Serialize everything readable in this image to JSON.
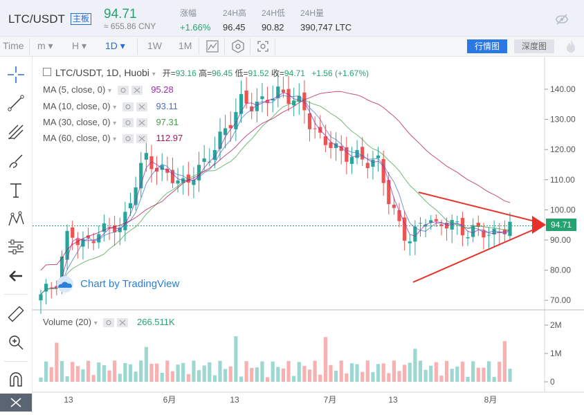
{
  "header": {
    "pair": "LTC/USDT",
    "board_badge": "主板",
    "price": "94.71",
    "price_cny": "≈ 655.86 CNY",
    "stats": [
      {
        "label": "涨幅",
        "value": "+1.66%",
        "color": "#26a270"
      },
      {
        "label": "24H高",
        "value": "96.45",
        "color": "#333333"
      },
      {
        "label": "24H低",
        "value": "90.82",
        "color": "#333333"
      },
      {
        "label": "24H量",
        "value": "390,747 LTC",
        "color": "#333333"
      }
    ]
  },
  "toolbar": {
    "time_label": "Time",
    "minute_label": "m",
    "hour_label": "H",
    "active_interval": "1D",
    "week_label": "1W",
    "month_label": "1M",
    "depth_button": "深度图",
    "market_button": "行情图"
  },
  "legend": {
    "symbol": "LTC/USDT, 1D, Huobi",
    "open_label": "开=",
    "open": "93.16",
    "high_label": "高=",
    "high": "96.45",
    "low_label": "低=",
    "low": "91.52",
    "close_label": "收=",
    "close": "94.71",
    "change": "+1.56 (+1.67%)"
  },
  "ma": [
    {
      "label": "MA (5, close, 0)",
      "value": "95.28",
      "color": "#9c27b0"
    },
    {
      "label": "MA (10, close, 0)",
      "value": "93.11",
      "color": "#4a6fc9"
    },
    {
      "label": "MA (30, close, 0)",
      "value": "97.31",
      "color": "#43a047"
    },
    {
      "label": "MA (60, close, 0)",
      "value": "112.97",
      "color": "#ad1457"
    }
  ],
  "price_axis": [
    "140.00",
    "130.00",
    "120.00",
    "110.00",
    "100.00",
    "90.00",
    "80.00",
    "70.00"
  ],
  "current_price_tag": "94.71",
  "watermark": "Chart by TradingView",
  "volume": {
    "label": "Volume (20)",
    "value": "266.511K",
    "axis": [
      "2M",
      "1M",
      "0"
    ]
  },
  "time_axis": [
    "13",
    "6月",
    "13",
    "7月",
    "13",
    "8月"
  ],
  "colors": {
    "up": "#26a69a",
    "down": "#ef5350",
    "accent": "#2a6cd6",
    "annotation": "#e8302a"
  }
}
